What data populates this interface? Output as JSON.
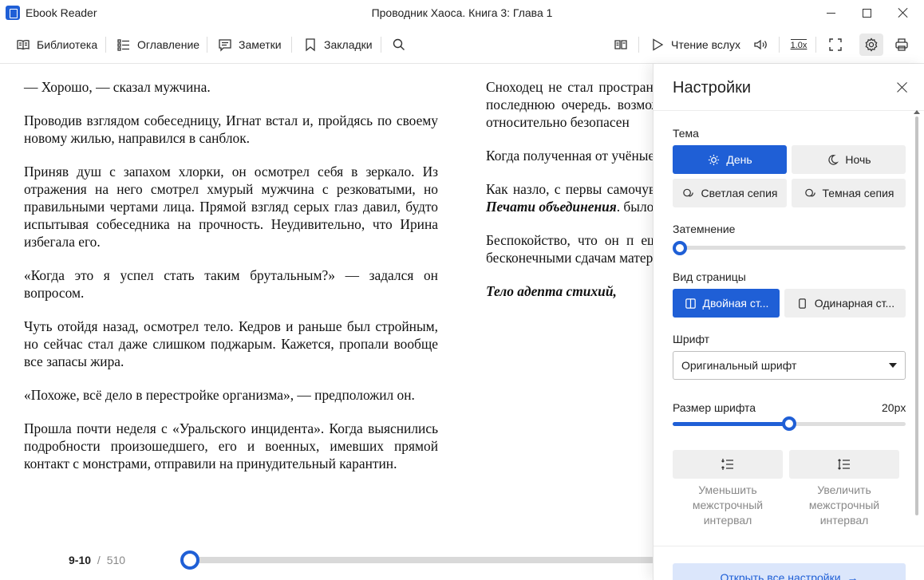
{
  "window": {
    "app_title": "Ebook Reader",
    "doc_title": "Проводник Хаоса. Книга 3: Глава 1"
  },
  "toolbar": {
    "library": "Библиотека",
    "contents": "Оглавление",
    "notes": "Заметки",
    "bookmarks": "Закладки",
    "read_aloud": "Чтение вслух",
    "speed": "1.0x"
  },
  "page_left": {
    "paragraphs": [
      "— Хорошо, — сказал мужчина.",
      "Проводив взглядом собеседницу, Игнат встал и, пройдясь по своему новому жилью, направился в санблок.",
      "Приняв душ с запахом хлорки, он осмотрел себя в зеркало. Из отражения на него смотрел хмурый мужчина с резковатыми, но правильными чертами лица. Прямой взгляд серых глаз давил, будто испытывая собеседника на прочность. Неудивительно, что Ирина избегала его.",
      "«Когда это я успел стать таким брутальным?» — задался он вопросом.",
      "Чуть отойдя назад, осмотрел тело. Кедров и раньше был стройным, но сейчас стал даже слишком поджарым. Кажется, пропали вообще все запасы жира.",
      "«Похоже, всё дело в перестройке организма», — предположил он.",
      "Прошла почти неделя с «Уральского инцидента». Когда выяснились подробности произошедшего, его и военных, имевших прямой контакт с монстрами, отправили на принудительный карантин."
    ]
  },
  "page_right": {
    "p1": "Сноходец не стал пространственной аном получилось бы, а быть у последнюю очередь. возможностью «позна аномалий. В отличие с относительно безопасен",
    "p2": "Когда полученная от учёные, которые контро ума. Игната определили",
    "p3_a": "Как назло, с первы самочувствие. Мужчина побочный эффект глоба",
    "p3_b": "Печати объединения",
    "p3_c": ". было иное мнение.",
    "p4": "Беспокойство, что он п ещё какую дрянь, пр заполнились всевоз бесконечными сдачам материала.",
    "p5": "Тело адепта стихий,"
  },
  "footer": {
    "current_pages": "9-10",
    "separator": "/",
    "total_pages": "510",
    "progress_fraction": 0.02
  },
  "settings": {
    "title": "Настройки",
    "theme_label": "Тема",
    "theme_day": "День",
    "theme_night": "Ночь",
    "theme_light_sepia": "Светлая сепия",
    "theme_dark_sepia": "Темная сепия",
    "dimming_label": "Затемнение",
    "dimming_value": 0,
    "page_view_label": "Вид страницы",
    "page_double": "Двойная ст...",
    "page_single": "Одинарная ст...",
    "font_label": "Шрифт",
    "font_value": "Оригинальный шрифт",
    "font_size_label": "Размер шрифта",
    "font_size_value": "20px",
    "font_size_fraction": 0.5,
    "decrease_line_spacing": "Уменьшить межстрочный интервал",
    "increase_line_spacing": "Увеличить межстрочный интервал",
    "open_all": "Открыть все настройки",
    "open_all_arrow": "→"
  },
  "colors": {
    "accent": "#1f5fd6",
    "button_bg": "#efefef",
    "open_all_bg": "#dbe6fb"
  }
}
